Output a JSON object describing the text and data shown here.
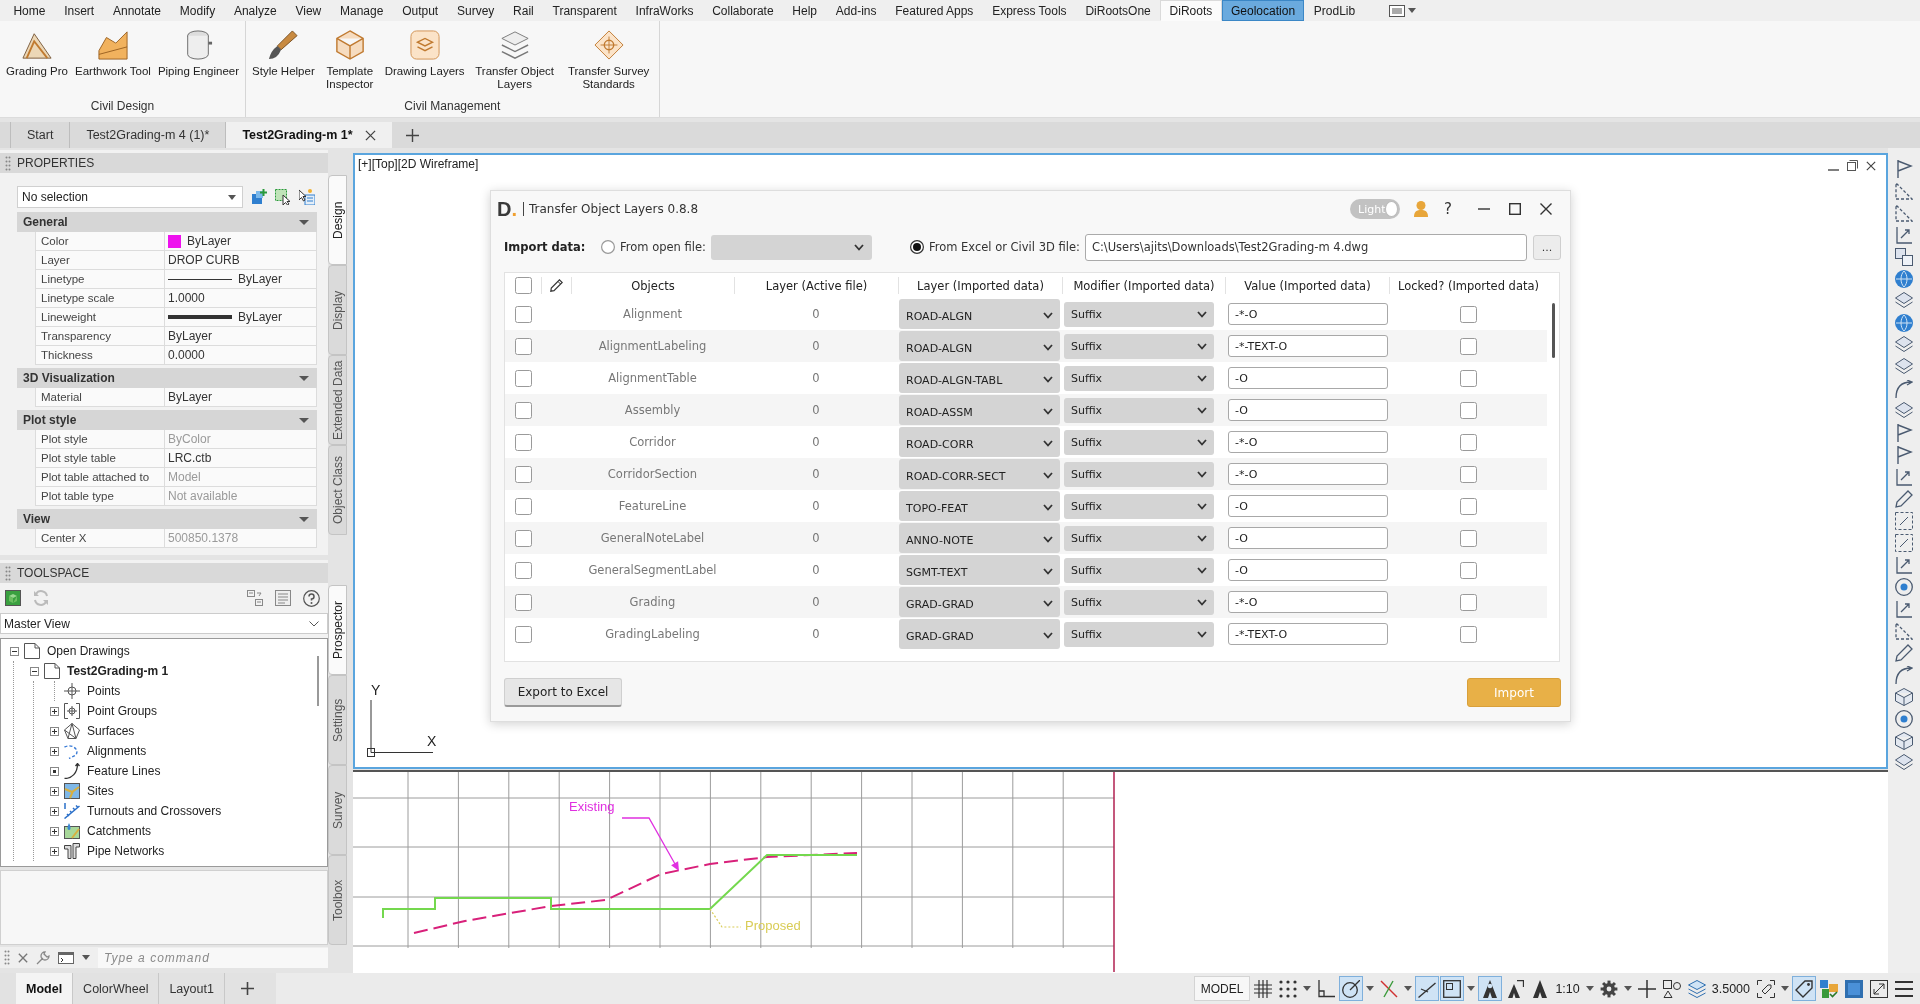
{
  "menu_bar": {
    "items": [
      {
        "label": "Home",
        "selected": false,
        "highlighted": false
      },
      {
        "label": "Insert",
        "selected": false,
        "highlighted": false
      },
      {
        "label": "Annotate",
        "selected": false,
        "highlighted": false
      },
      {
        "label": "Modify",
        "selected": false,
        "highlighted": false
      },
      {
        "label": "Analyze",
        "selected": false,
        "highlighted": false
      },
      {
        "label": "View",
        "selected": false,
        "highlighted": false
      },
      {
        "label": "Manage",
        "selected": false,
        "highlighted": false
      },
      {
        "label": "Output",
        "selected": false,
        "highlighted": false
      },
      {
        "label": "Survey",
        "selected": false,
        "highlighted": false
      },
      {
        "label": "Rail",
        "selected": false,
        "highlighted": false
      },
      {
        "label": "Transparent",
        "selected": false,
        "highlighted": false
      },
      {
        "label": "InfraWorks",
        "selected": false,
        "highlighted": false
      },
      {
        "label": "Collaborate",
        "selected": false,
        "highlighted": false
      },
      {
        "label": "Help",
        "selected": false,
        "highlighted": false
      },
      {
        "label": "Add-ins",
        "selected": false,
        "highlighted": false
      },
      {
        "label": "Featured Apps",
        "selected": false,
        "highlighted": false
      },
      {
        "label": "Express Tools",
        "selected": false,
        "highlighted": false
      },
      {
        "label": "DiRootsOne",
        "selected": false,
        "highlighted": false
      },
      {
        "label": "DiRoots",
        "selected": true,
        "highlighted": false
      },
      {
        "label": "Geolocation",
        "selected": false,
        "highlighted": true
      },
      {
        "label": "ProdLib",
        "selected": false,
        "highlighted": false
      }
    ]
  },
  "ribbon": {
    "panels": [
      {
        "title": "Civil Design",
        "tools": [
          {
            "label": "Grading Pro",
            "kind": "grading"
          },
          {
            "label": "Earthwork Tool",
            "kind": "earthwork"
          },
          {
            "label": "Piping Engineer",
            "kind": "piping"
          }
        ]
      },
      {
        "title": "Civil Management",
        "tools": [
          {
            "label": "Style Helper",
            "kind": "brush"
          },
          {
            "label": "Template Inspector",
            "kind": "cube"
          },
          {
            "label": "Drawing Layers",
            "kind": "layers"
          },
          {
            "label": "Transfer Object Layers",
            "kind": "transfer-layers"
          },
          {
            "label": "Transfer Survey Standards",
            "kind": "survey"
          }
        ]
      }
    ]
  },
  "file_tabs": [
    {
      "label": "Start",
      "selected": false,
      "closable": false
    },
    {
      "label": "Test2Grading-m 4 (1)*",
      "selected": false,
      "closable": false
    },
    {
      "label": "Test2Grading-m 1*",
      "selected": true,
      "closable": true
    }
  ],
  "properties": {
    "title": "PROPERTIES",
    "selection": "No selection",
    "sections": [
      {
        "title": "General",
        "expanded": true,
        "rows": [
          {
            "label": "Color",
            "value": "ByLayer",
            "kind": "color",
            "color": "#ee11ee",
            "disabled": false
          },
          {
            "label": "Layer",
            "value": "DROP CURB",
            "kind": "text",
            "disabled": false
          },
          {
            "label": "Linetype",
            "value": "ByLayer",
            "kind": "linetype",
            "disabled": false
          },
          {
            "label": "Linetype scale",
            "value": "1.0000",
            "kind": "text",
            "disabled": false
          },
          {
            "label": "Lineweight",
            "value": "ByLayer",
            "kind": "lineweight",
            "disabled": false
          },
          {
            "label": "Transparency",
            "value": "ByLayer",
            "kind": "text",
            "disabled": false
          },
          {
            "label": "Thickness",
            "value": "0.0000",
            "kind": "text",
            "disabled": false
          }
        ]
      },
      {
        "title": "3D Visualization",
        "expanded": true,
        "rows": [
          {
            "label": "Material",
            "value": "ByLayer",
            "kind": "text",
            "disabled": false
          }
        ]
      },
      {
        "title": "Plot style",
        "expanded": true,
        "rows": [
          {
            "label": "Plot style",
            "value": "ByColor",
            "kind": "text",
            "disabled": true
          },
          {
            "label": "Plot style table",
            "value": "LRC.ctb",
            "kind": "text",
            "disabled": false
          },
          {
            "label": "Plot table attached to",
            "value": "Model",
            "kind": "text",
            "disabled": true
          },
          {
            "label": "Plot table type",
            "value": "Not available",
            "kind": "text",
            "disabled": true
          }
        ]
      },
      {
        "title": "View",
        "expanded": true,
        "rows": [
          {
            "label": "Center X",
            "value": "500850.1378",
            "kind": "text",
            "disabled": true
          }
        ]
      }
    ],
    "side_tabs": [
      {
        "label": "Design",
        "selected": true
      },
      {
        "label": "Display",
        "selected": false
      },
      {
        "label": "Extended Data",
        "selected": false
      },
      {
        "label": "Object Class",
        "selected": false
      }
    ]
  },
  "toolspace": {
    "title": "TOOLSPACE",
    "view": "Master View",
    "tree": [
      {
        "label": "Open Drawings",
        "kind": "expanded",
        "current": false,
        "children": [
          {
            "label": "Test2Grading-m 1",
            "kind": "expanded",
            "current": true,
            "children": [
              {
                "label": "Points",
                "kind": "leaf",
                "current": false
              },
              {
                "label": "Point Groups",
                "kind": "collapsed",
                "current": false
              },
              {
                "label": "Surfaces",
                "kind": "collapsed",
                "current": false
              },
              {
                "label": "Alignments",
                "kind": "collapsed",
                "current": false
              },
              {
                "label": "Feature Lines",
                "kind": "pending",
                "current": false
              },
              {
                "label": "Sites",
                "kind": "collapsed",
                "current": false
              },
              {
                "label": "Turnouts and Crossovers",
                "kind": "collapsed",
                "current": false
              },
              {
                "label": "Catchments",
                "kind": "collapsed",
                "current": false
              },
              {
                "label": "Pipe Networks",
                "kind": "collapsed",
                "current": false
              }
            ]
          }
        ]
      }
    ],
    "side_tabs": [
      {
        "label": "Prospector",
        "selected": true
      },
      {
        "label": "Settings",
        "selected": false
      },
      {
        "label": "Survey",
        "selected": false
      },
      {
        "label": "Toolbox",
        "selected": false
      }
    ]
  },
  "command_line": {
    "placeholder": "Type a command"
  },
  "viewport": {
    "label": "[+][Top][2D Wireframe]",
    "ucs": {
      "y_label": "Y",
      "x_label": "X"
    }
  },
  "dialog": {
    "logo": "D.",
    "title": "Transfer Object Layers 0.8.8",
    "theme_toggle": {
      "label": "Light",
      "on": true
    },
    "help": "?",
    "import": {
      "label": "Import data:",
      "options": [
        {
          "label": "From open file:",
          "kind": "dropdown",
          "selected": false
        },
        {
          "label": "From Excel or Civil 3D file:",
          "kind": "path",
          "selected": true,
          "value": "C:\\Users\\ajits\\Downloads\\Test2Grading-m 4.dwg"
        }
      ],
      "browse": "..."
    },
    "table": {
      "all_checked": false,
      "columns": [
        "Objects",
        "Layer (Active file)",
        "Layer (Imported data)",
        "Modifier (Imported data)",
        "Value (Imported data)",
        "Locked? (Imported data)"
      ],
      "rows": [
        {
          "checked": false,
          "object": "Alignment",
          "active_layer": "0",
          "imported_layer": "ROAD-ALGN",
          "modifier": "Suffix",
          "value": "-*-O",
          "locked": false
        },
        {
          "checked": false,
          "object": "AlignmentLabeling",
          "active_layer": "0",
          "imported_layer": "ROAD-ALGN",
          "modifier": "Suffix",
          "value": "-*-TEXT-O",
          "locked": false
        },
        {
          "checked": false,
          "object": "AlignmentTable",
          "active_layer": "0",
          "imported_layer": "ROAD-ALGN-TABL",
          "modifier": "Suffix",
          "value": "-O",
          "locked": false
        },
        {
          "checked": false,
          "object": "Assembly",
          "active_layer": "0",
          "imported_layer": "ROAD-ASSM",
          "modifier": "Suffix",
          "value": "-O",
          "locked": false
        },
        {
          "checked": false,
          "object": "Corridor",
          "active_layer": "0",
          "imported_layer": "ROAD-CORR",
          "modifier": "Suffix",
          "value": "-*-O",
          "locked": false
        },
        {
          "checked": false,
          "object": "CorridorSection",
          "active_layer": "0",
          "imported_layer": "ROAD-CORR-SECT",
          "modifier": "Suffix",
          "value": "-*-O",
          "locked": false
        },
        {
          "checked": false,
          "object": "FeatureLine",
          "active_layer": "0",
          "imported_layer": "TOPO-FEAT",
          "modifier": "Suffix",
          "value": "-O",
          "locked": false
        },
        {
          "checked": false,
          "object": "GeneralNoteLabel",
          "active_layer": "0",
          "imported_layer": "ANNO-NOTE",
          "modifier": "Suffix",
          "value": "-O",
          "locked": false
        },
        {
          "checked": false,
          "object": "GeneralSegmentLabel",
          "active_layer": "0",
          "imported_layer": "SGMT-TEXT",
          "modifier": "Suffix",
          "value": "-O",
          "locked": false
        },
        {
          "checked": false,
          "object": "Grading",
          "active_layer": "0",
          "imported_layer": "GRAD-GRAD",
          "modifier": "Suffix",
          "value": "-*-O",
          "locked": false
        },
        {
          "checked": false,
          "object": "GradingLabeling",
          "active_layer": "0",
          "imported_layer": "GRAD-GRAD",
          "modifier": "Suffix",
          "value": "-*-TEXT-O",
          "locked": false
        }
      ]
    },
    "buttons": [
      {
        "label": "Export to Excel",
        "kind": "secondary"
      },
      {
        "label": "Import",
        "kind": "primary"
      }
    ]
  },
  "profile_view": {
    "labels": [
      {
        "text": "Existing",
        "kind": "existing",
        "color": "#e030e0"
      },
      {
        "text": "Proposed",
        "kind": "proposed",
        "color": "#d9cc55"
      }
    ]
  },
  "status_bar": {
    "layout_tabs": [
      {
        "label": "Model",
        "selected": true
      },
      {
        "label": "ColorWheel",
        "selected": false
      },
      {
        "label": "Layout1",
        "selected": false
      }
    ],
    "tools": [
      {
        "kind": "model",
        "label": "MODEL",
        "on": false
      },
      {
        "kind": "grid",
        "on": false
      },
      {
        "kind": "snap",
        "on": false
      },
      {
        "kind": "menu-caret",
        "on": false
      },
      {
        "kind": "ortho",
        "on": false
      },
      {
        "kind": "polar",
        "on": true
      },
      {
        "kind": "menu-caret",
        "on": false
      },
      {
        "kind": "isodraft",
        "on": false
      },
      {
        "kind": "menu-caret",
        "on": false
      },
      {
        "kind": "object-snap-tracking",
        "on": true
      },
      {
        "kind": "object-snap",
        "on": true
      },
      {
        "kind": "menu-caret",
        "on": false
      },
      {
        "kind": "annotation-visibility",
        "on": true
      },
      {
        "kind": "autoscale",
        "on": false
      },
      {
        "kind": "annotation-scale",
        "label": "1:10",
        "on": false
      },
      {
        "kind": "menu-caret",
        "on": false
      },
      {
        "kind": "workspace",
        "on": false
      },
      {
        "kind": "menu-caret",
        "on": false
      },
      {
        "kind": "annotation-monitor",
        "on": false
      },
      {
        "kind": "isolate",
        "on": false
      },
      {
        "kind": "layer-elevation",
        "label": "3.5000",
        "on": false
      },
      {
        "kind": "selection-cycling",
        "on": false
      },
      {
        "kind": "menu-caret",
        "on": false
      },
      {
        "kind": "object-tag",
        "on": true
      },
      {
        "kind": "hardware",
        "on": false
      },
      {
        "kind": "properties-panel",
        "on": false
      },
      {
        "kind": "fullscreen",
        "on": false
      },
      {
        "kind": "customize",
        "on": false
      }
    ]
  }
}
